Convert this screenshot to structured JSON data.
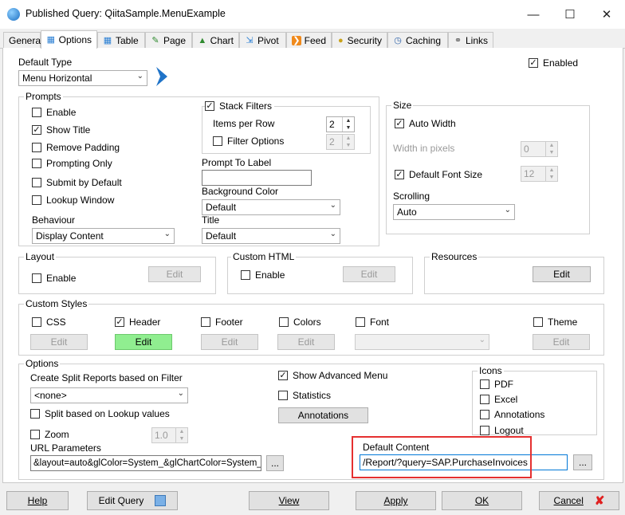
{
  "window": {
    "title": "Published Query: QiitaSample.MenuExample"
  },
  "tabs": [
    {
      "label": "General",
      "icon": "none"
    },
    {
      "label": "Options",
      "icon": "options-icon"
    },
    {
      "label": "Table",
      "icon": "table-icon"
    },
    {
      "label": "Page",
      "icon": "page-icon"
    },
    {
      "label": "Chart",
      "icon": "chart-icon"
    },
    {
      "label": "Pivot",
      "icon": "pivot-icon"
    },
    {
      "label": "Feed",
      "icon": "feed-icon"
    },
    {
      "label": "Security",
      "icon": "lock-icon"
    },
    {
      "label": "Caching",
      "icon": "clock-icon"
    },
    {
      "label": "Links",
      "icon": "link-icon"
    }
  ],
  "default_type": {
    "label": "Default Type",
    "value": "Menu Horizontal"
  },
  "enabled": {
    "label": "Enabled",
    "checked": true
  },
  "prompts": {
    "label": "Prompts",
    "enable": "Enable",
    "show_title": "Show Title",
    "remove_padding": "Remove Padding",
    "prompting_only": "Prompting Only",
    "submit_by_default": "Submit by Default",
    "lookup_window": "Lookup Window",
    "behaviour_label": "Behaviour",
    "behaviour_value": "Display Content",
    "stack_filters": "Stack Filters",
    "items_per_row_label": "Items per Row",
    "items_per_row_value": "2",
    "filter_options": "Filter Options",
    "filter_options_value": "2",
    "prompt_to_label": "Prompt To Label",
    "prompt_to_value": "",
    "background_color_label": "Background Color",
    "background_color_value": "Default",
    "title_label": "Title",
    "title_value": "Default"
  },
  "size": {
    "label": "Size",
    "auto_width": "Auto Width",
    "width_label": "Width in pixels",
    "width_value": "0",
    "default_font_size": "Default Font Size",
    "font_size_value": "12",
    "scrolling_label": "Scrolling",
    "scrolling_value": "Auto"
  },
  "layout": {
    "label": "Layout",
    "enable": "Enable",
    "edit": "Edit"
  },
  "custom_html": {
    "label": "Custom HTML",
    "enable": "Enable",
    "edit": "Edit"
  },
  "resources": {
    "label": "Resources",
    "edit": "Edit"
  },
  "custom_styles": {
    "label": "Custom Styles",
    "css": "CSS",
    "header": "Header",
    "footer": "Footer",
    "colors": "Colors",
    "font": "Font",
    "theme": "Theme",
    "edit": "Edit",
    "font_value": ""
  },
  "options": {
    "label": "Options",
    "split_label": "Create Split Reports based on Filter",
    "split_value": "<none>",
    "split_lookup": "Split based on Lookup values",
    "zoom": "Zoom",
    "zoom_value": "1.0",
    "url_params_label": "URL Parameters",
    "url_params_value": "&layout=auto&glColor=System_&glChartColor=System_",
    "ellipsis": "...",
    "show_advanced_menu": "Show Advanced Menu",
    "statistics": "Statistics",
    "annotations_button": "Annotations",
    "default_content_label": "Default Content",
    "default_content_value": "/Report/?query=SAP.PurchaseInvoices"
  },
  "icons_group": {
    "label": "Icons",
    "pdf": "PDF",
    "excel": "Excel",
    "annotations": "Annotations",
    "logout": "Logout"
  },
  "footer": {
    "help": "Help",
    "edit_query": "Edit Query",
    "view": "View",
    "apply": "Apply",
    "ok": "OK",
    "cancel": "Cancel"
  },
  "colors": {
    "accent": "#0078d7",
    "highlight": "#e53030",
    "green_button": "#90ee90"
  }
}
